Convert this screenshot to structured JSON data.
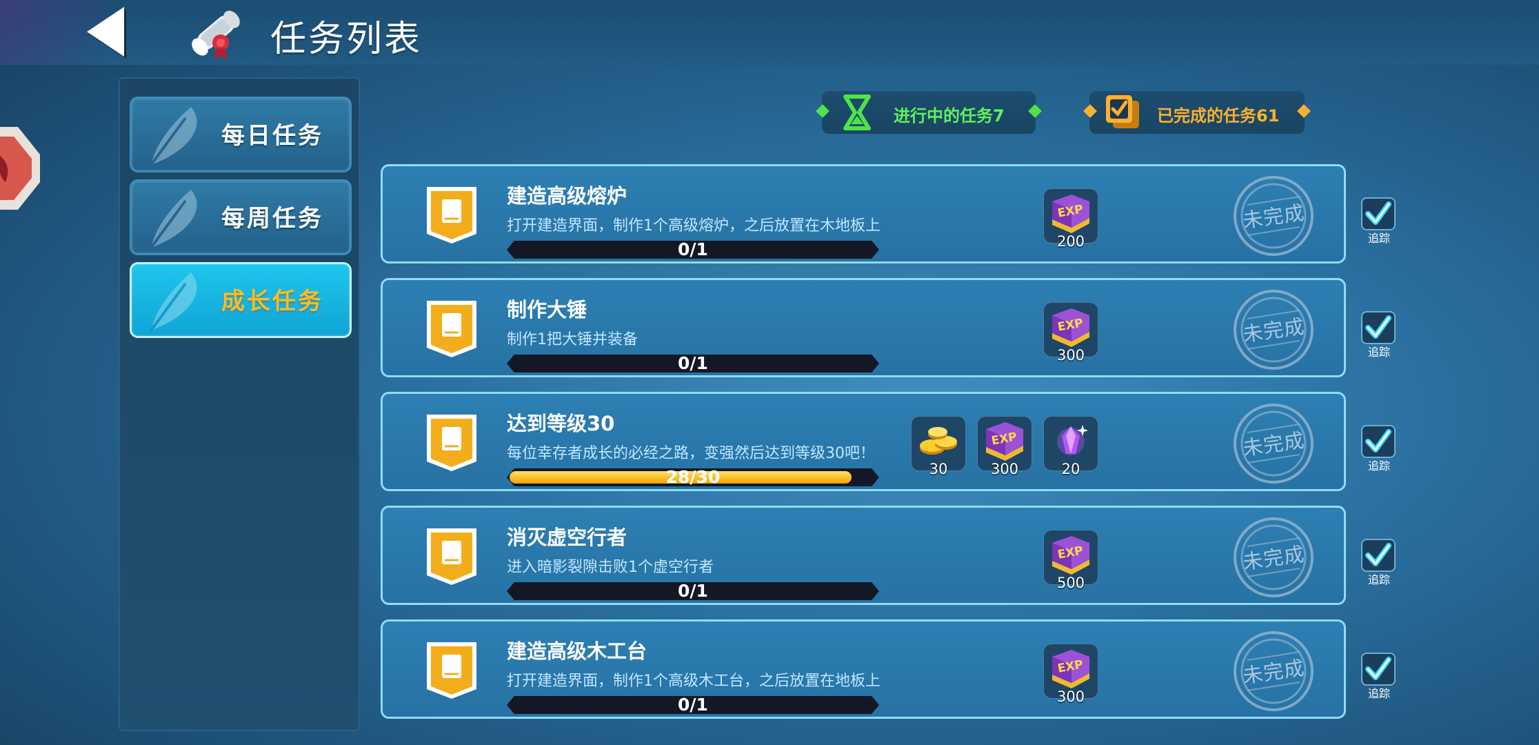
{
  "header": {
    "title": "任务列表"
  },
  "sidebar": {
    "tabs": [
      {
        "label": "每日任务",
        "active": false
      },
      {
        "label": "每周任务",
        "active": false
      },
      {
        "label": "成长任务",
        "active": true
      }
    ]
  },
  "status": {
    "in_progress": "进行中的任务7",
    "completed": "已完成的任务61"
  },
  "quests": [
    {
      "title": "建造高级熔炉",
      "desc": "打开建造界面，制作1个高级熔炉，之后放置在木地板上",
      "progress_text": "0/1",
      "progress": 0,
      "rewards": [
        {
          "icon": "exp-book-icon",
          "count": "200"
        }
      ],
      "status": "未完成",
      "track_label": "追踪",
      "tracked": true
    },
    {
      "title": "制作大锤",
      "desc": "制作1把大锤并装备",
      "progress_text": "0/1",
      "progress": 0,
      "rewards": [
        {
          "icon": "exp-book-icon",
          "count": "300"
        }
      ],
      "status": "未完成",
      "track_label": "追踪",
      "tracked": true
    },
    {
      "title": "达到等级30",
      "desc": "每位幸存者成长的必经之路，变强然后达到等级30吧！",
      "progress_text": "28/30",
      "progress": 0.933,
      "rewards": [
        {
          "icon": "gold-coins-icon",
          "count": "30"
        },
        {
          "icon": "exp-book-icon",
          "count": "300"
        },
        {
          "icon": "purple-gem-icon",
          "count": "20"
        }
      ],
      "status": "未完成",
      "track_label": "追踪",
      "tracked": true
    },
    {
      "title": "消灭虚空行者",
      "desc": "进入暗影裂隙击败1个虚空行者",
      "progress_text": "0/1",
      "progress": 0,
      "rewards": [
        {
          "icon": "exp-book-icon",
          "count": "500"
        }
      ],
      "status": "未完成",
      "track_label": "追踪",
      "tracked": true
    },
    {
      "title": "建造高级木工台",
      "desc": "打开建造界面，制作1个高级木工台，之后放置在地板上",
      "progress_text": "0/1",
      "progress": 0,
      "rewards": [
        {
          "icon": "exp-book-icon",
          "count": "300"
        }
      ],
      "status": "未完成",
      "track_label": "追踪",
      "tracked": true
    }
  ],
  "colors": {
    "accent_green": "#4fe34a",
    "accent_orange": "#ffb02e",
    "active_tab": "#19b7e3",
    "progress_fill": "#f2a200"
  }
}
